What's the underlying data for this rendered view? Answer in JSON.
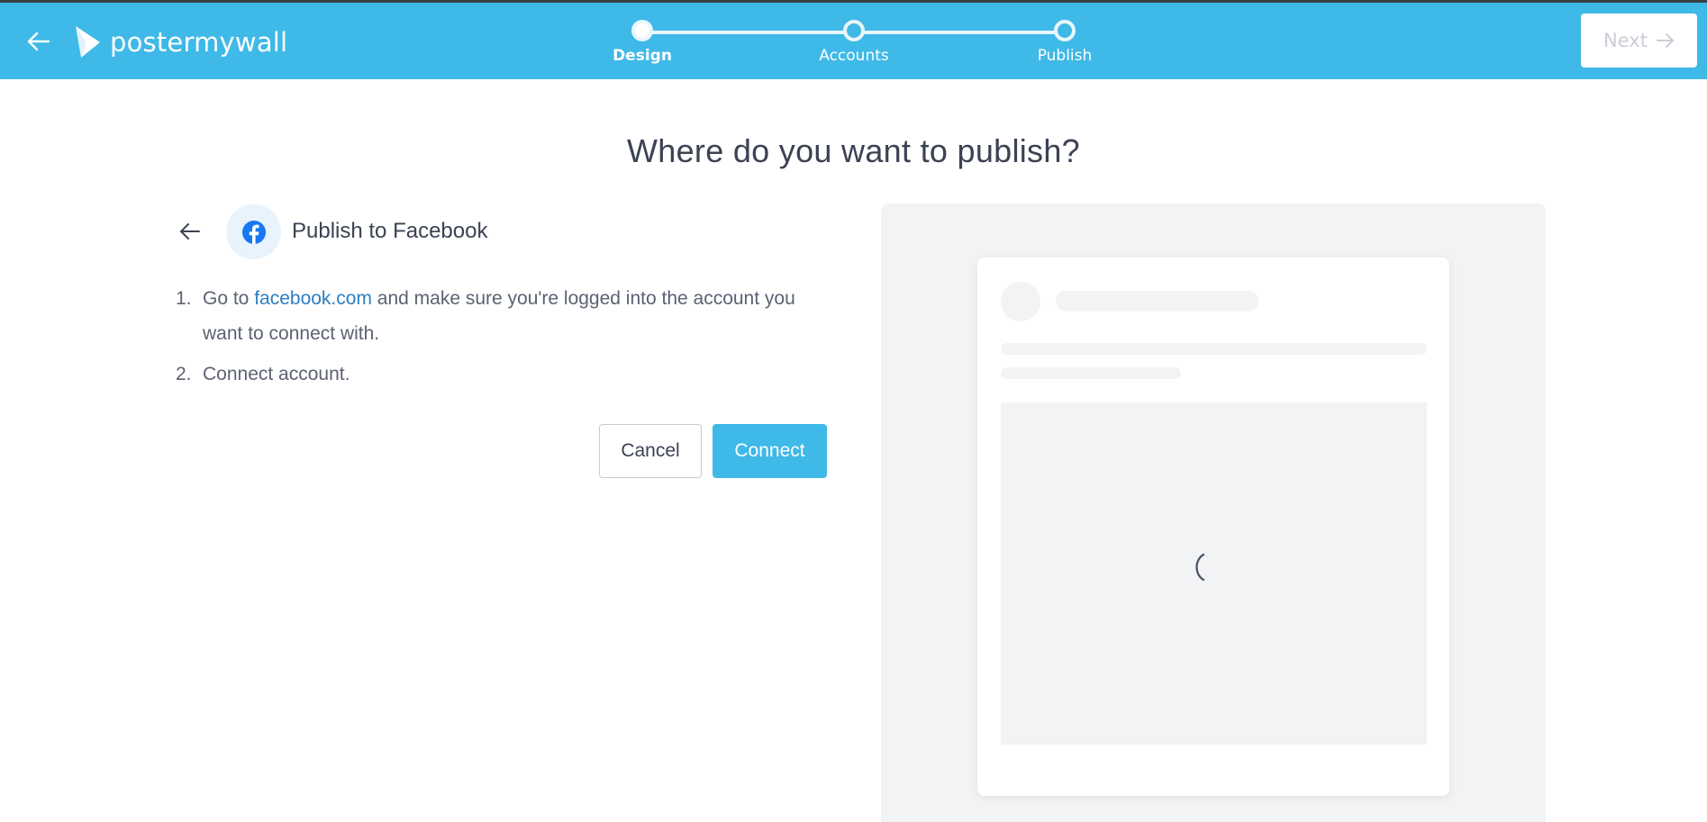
{
  "header": {
    "brand": "postermywall",
    "steps": [
      {
        "label": "Design",
        "active": true
      },
      {
        "label": "Accounts",
        "active": false
      },
      {
        "label": "Publish",
        "active": false
      }
    ],
    "next_label": "Next"
  },
  "main": {
    "title": "Where do you want to publish?",
    "panel_title": "Publish to Facebook",
    "instructions": {
      "step1_num": "1.",
      "step1_pre": "Go to ",
      "step1_link": "facebook.com",
      "step1_post": " and make sure you're logged into the account you want to connect with.",
      "step2_num": "2.",
      "step2_text": "Connect account."
    },
    "cancel_label": "Cancel",
    "connect_label": "Connect"
  },
  "colors": {
    "header_bg": "#3fb9e7",
    "link": "#2c7ec2",
    "facebook": "#1877f2"
  }
}
